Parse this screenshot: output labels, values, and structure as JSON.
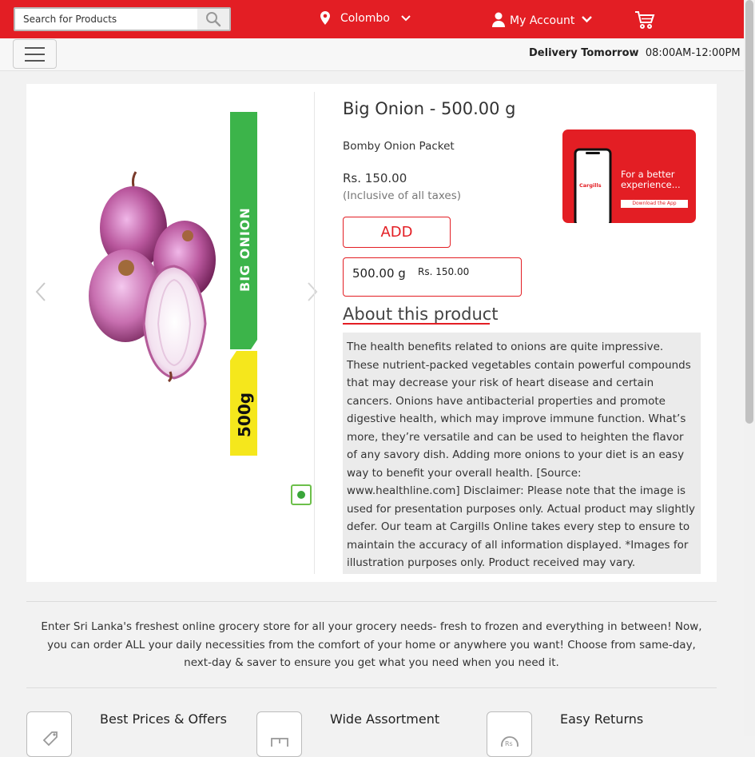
{
  "header": {
    "search_placeholder": "Search for Products",
    "location": "Colombo",
    "account_label": "My Account"
  },
  "subheader": {
    "delivery_label": "Delivery Tomorrow",
    "delivery_time": "08:00AM-12:00PM"
  },
  "product": {
    "title": "Big Onion - 500.00 g",
    "subtitle": "Bomby Onion Packet",
    "price": "Rs. 150.00",
    "tax_note": "(Inclusive of all taxes)",
    "add_label": "ADD",
    "variant_weight": "500.00 g",
    "variant_price": "Rs. 150.00",
    "package_label_name": "BIG ONION",
    "package_label_weight": "500g",
    "about_heading": "About this product",
    "description": "The health benefits related to onions are quite impressive. These nutrient-packed vegetables contain powerful compounds that may decrease your risk of heart disease and certain cancers. Onions have antibacterial properties and promote digestive health, which may improve immune function. What’s more, they’re versatile and can be used to heighten the flavor of any savory dish. Adding more onions to your diet is an easy way to benefit your overall health. [Source: www.healthline.com] Disclaimer: Please note that the image is used for presentation purposes only. Actual product may slightly defer. Our team at Cargills Online takes every step to ensure to maintain the accuracy of all information displayed. *Images for illustration purposes only. Product received may vary."
  },
  "promo": {
    "brand": "Cargills",
    "text": "For a better experience...",
    "button": "Download the App"
  },
  "footer": {
    "intro": "Enter Sri Lanka's freshest online grocery store for all your grocery needs- fresh to frozen and everything in between! Now, you can order ALL your daily necessities from the comfort of your home or anywhere you want! Choose from same-day, next-day & saver to ensure you get what you need when you need it.",
    "features": [
      {
        "title": "Best Prices & Offers",
        "icon": "tag-icon"
      },
      {
        "title": "Wide Assortment",
        "icon": "box-icon"
      },
      {
        "title": "Easy Returns",
        "icon": "rupee-icon"
      }
    ]
  },
  "colors": {
    "brand_red": "#e31e24",
    "label_green": "#3cb44a",
    "label_yellow": "#f5e71c"
  }
}
